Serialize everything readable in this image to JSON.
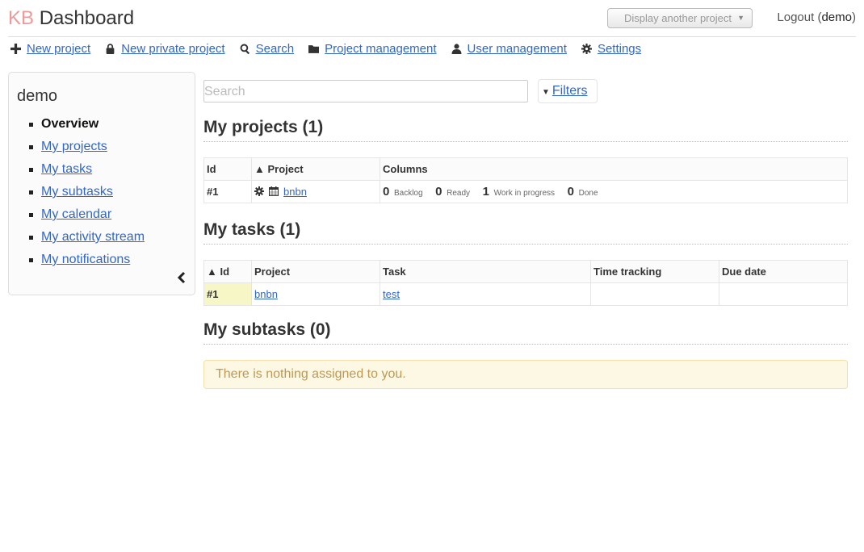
{
  "header": {
    "logo_kb": "KB",
    "title": "Dashboard",
    "project_select": "Display another project",
    "logout": "Logout",
    "username": "demo"
  },
  "menu": [
    {
      "label": "New project",
      "icon": "plus-icon"
    },
    {
      "label": "New private project",
      "icon": "lock-icon"
    },
    {
      "label": "Search",
      "icon": "search-icon"
    },
    {
      "label": "Project management",
      "icon": "folder-icon"
    },
    {
      "label": "User management",
      "icon": "user-icon"
    },
    {
      "label": "Settings",
      "icon": "gear-icon"
    }
  ],
  "sidebar": {
    "title": "demo",
    "items": [
      {
        "label": "Overview"
      },
      {
        "label": "My projects"
      },
      {
        "label": "My tasks"
      },
      {
        "label": "My subtasks"
      },
      {
        "label": "My calendar"
      },
      {
        "label": "My activity stream"
      },
      {
        "label": "My notifications"
      }
    ]
  },
  "search": {
    "placeholder": "Search",
    "value": ""
  },
  "filters_label": "Filters",
  "projects": {
    "title": "My projects (1)",
    "headers": [
      "Id",
      "▲ Project",
      "Columns"
    ],
    "rows": [
      {
        "id": "#1",
        "name": "bnbn",
        "columns": [
          {
            "count": "0",
            "name": "Backlog"
          },
          {
            "count": "0",
            "name": "Ready"
          },
          {
            "count": "1",
            "name": "Work in progress"
          },
          {
            "count": "0",
            "name": "Done"
          }
        ]
      }
    ]
  },
  "tasks": {
    "title": "My tasks (1)",
    "headers": [
      "▲ Id",
      "Project",
      "Task",
      "Time tracking",
      "Due date"
    ],
    "rows": [
      {
        "id": "#1",
        "project": "bnbn",
        "task": "test",
        "time_tracking": "",
        "due_date": ""
      }
    ]
  },
  "subtasks": {
    "title": "My subtasks (0)",
    "empty_message": "There is nothing assigned to you."
  },
  "colors": {
    "link": "#3366cc",
    "logo_kb": "#ec9a9a",
    "alert_bg": "#fcf8e3",
    "alert_text": "#c09853",
    "highlight": "#f6f6c6"
  }
}
